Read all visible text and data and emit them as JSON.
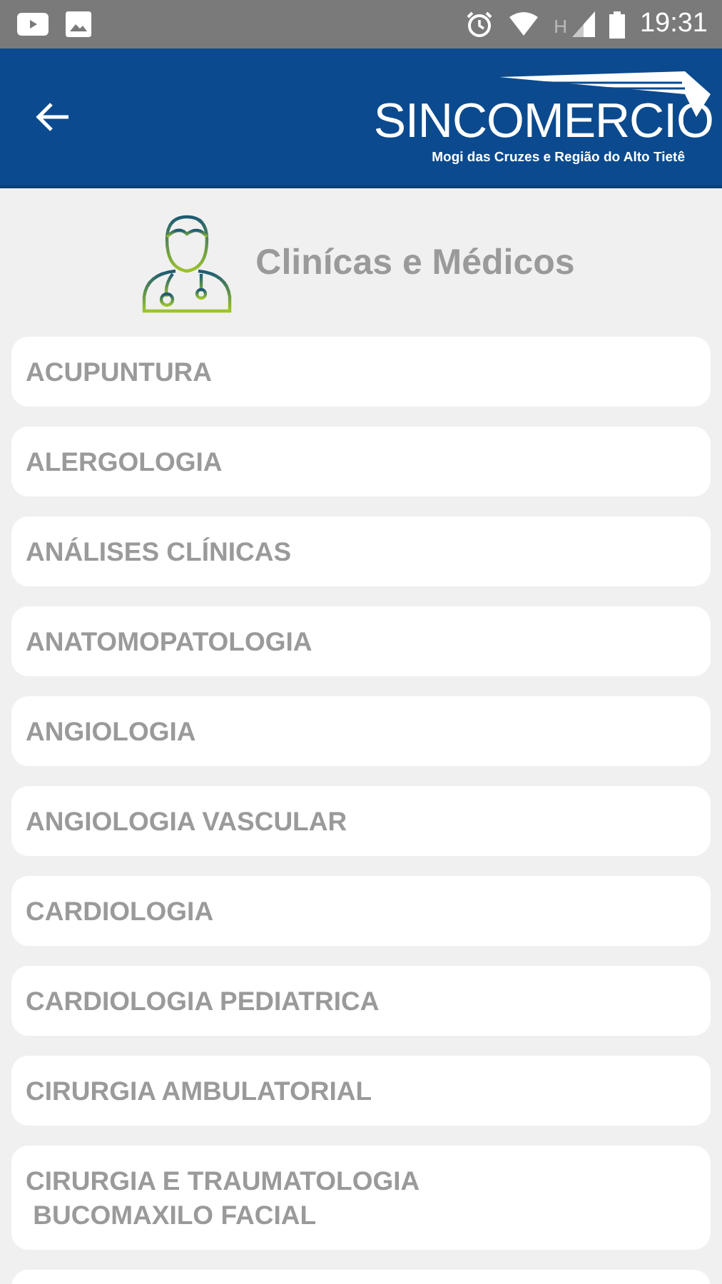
{
  "status_bar": {
    "network_label": "H",
    "time": "19:31"
  },
  "header": {
    "logo_name": "SINCOMERCIO",
    "logo_tagline": "Mogi das Cruzes e Região do Alto Tietê"
  },
  "section": {
    "title": "Clinícas e Médicos"
  },
  "items": [
    {
      "label": "ACUPUNTURA"
    },
    {
      "label": "ALERGOLOGIA"
    },
    {
      "label": "ANÁLISES CLÍNICAS"
    },
    {
      "label": "ANATOMOPATOLOGIA"
    },
    {
      "label": "ANGIOLOGIA"
    },
    {
      "label": "ANGIOLOGIA VASCULAR"
    },
    {
      "label": "CARDIOLOGIA"
    },
    {
      "label": "CARDIOLOGIA PEDIATRICA"
    },
    {
      "label": "CIRURGIA AMBULATORIAL"
    },
    {
      "label": "CIRURGIA E TRAUMATOLOGIA\n BUCOMAXILO FACIAL"
    }
  ]
}
